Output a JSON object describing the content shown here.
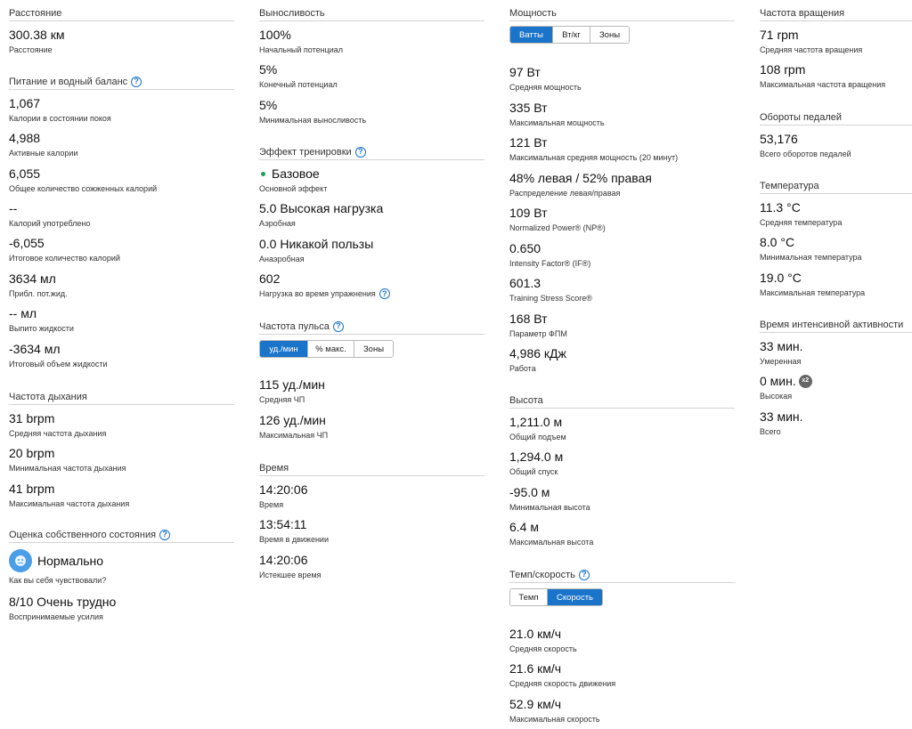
{
  "col1": {
    "distance": {
      "title": "Расстояние",
      "value": "300.38 км",
      "label": "Расстояние"
    },
    "nutrition": {
      "title": "Питание и водный баланс",
      "items": [
        {
          "value": "1,067",
          "label": "Калории в состоянии покоя"
        },
        {
          "value": "4,988",
          "label": "Активные калории"
        },
        {
          "value": "6,055",
          "label": "Общее количество сожженных калорий"
        },
        {
          "value": "--",
          "label": "Калорий употреблено"
        },
        {
          "value": "-6,055",
          "label": "Итоговое количество калорий"
        },
        {
          "value": "3634 мл",
          "label": "Прибл. пот.жид."
        },
        {
          "value": "-- мл",
          "label": "Выпито жидкости"
        },
        {
          "value": "-3634 мл",
          "label": "Итоговый объем жидкости"
        }
      ]
    },
    "breathing": {
      "title": "Частота дыхания",
      "items": [
        {
          "value": "31 brpm",
          "label": "Средняя частота дыхания"
        },
        {
          "value": "20 brpm",
          "label": "Минимальная частота дыхания"
        },
        {
          "value": "41 brpm",
          "label": "Максимальная частота дыхания"
        }
      ]
    },
    "self_eval": {
      "title": "Оценка собственного состояния",
      "feeling_value": "Нормально",
      "feeling_label": "Как вы себя чувствовали?",
      "effort_value": "8/10 Очень трудно",
      "effort_label": "Воспринимаемые усилия"
    }
  },
  "col2": {
    "stamina": {
      "title": "Выносливость",
      "items": [
        {
          "value": "100%",
          "label": "Начальный потенциал"
        },
        {
          "value": "5%",
          "label": "Конечный потенциал"
        },
        {
          "value": "5%",
          "label": "Минимальная выносливость"
        }
      ]
    },
    "training_effect": {
      "title": "Эффект тренировки",
      "primary_value": "Базовое",
      "primary_label": "Основной эффект",
      "aerobic_value": "5.0 Высокая нагрузка",
      "aerobic_label": "Аэробная",
      "anaerobic_value": "0.0 Никакой пользы",
      "anaerobic_label": "Анаэробная",
      "load_value": "602",
      "load_label": "Нагрузка во время упражнения"
    },
    "heart_rate": {
      "title": "Частота пульса",
      "tabs": [
        "уд./мин",
        "% макс.",
        "Зоны"
      ],
      "active_tab": "уд./мин",
      "items": [
        {
          "value": "115 уд./мин",
          "label": "Средняя ЧП"
        },
        {
          "value": "126 уд./мин",
          "label": "Максимальная ЧП"
        }
      ]
    },
    "time": {
      "title": "Время",
      "items": [
        {
          "value": "14:20:06",
          "label": "Время"
        },
        {
          "value": "13:54:11",
          "label": "Время в движении"
        },
        {
          "value": "14:20:06",
          "label": "Истекшее время"
        }
      ]
    }
  },
  "col3": {
    "power": {
      "title": "Мощность",
      "tabs": [
        "Ватты",
        "Вт/кг",
        "Зоны"
      ],
      "active_tab": "Ватты",
      "items": [
        {
          "value": "97 Вт",
          "label": "Средняя мощность"
        },
        {
          "value": "335 Вт",
          "label": "Максимальная мощность"
        },
        {
          "value": "121 Вт",
          "label": "Максимальная средняя мощность (20 минут)"
        },
        {
          "value": "48% левая / 52% правая",
          "label": "Распределение левая/правая"
        },
        {
          "value": "109 Вт",
          "label": "Normalized Power® (NP®)"
        },
        {
          "value": "0.650",
          "label": "Intensity Factor® (IF®)"
        },
        {
          "value": "601.3",
          "label": "Training Stress Score®"
        },
        {
          "value": "168 Вт",
          "label": "Параметр ФПМ"
        },
        {
          "value": "4,986 кДж",
          "label": "Работа"
        }
      ]
    },
    "elevation": {
      "title": "Высота",
      "items": [
        {
          "value": "1,211.0 м",
          "label": "Общий подъем"
        },
        {
          "value": "1,294.0 м",
          "label": "Общий спуск"
        },
        {
          "value": "-95.0 м",
          "label": "Минимальная высота"
        },
        {
          "value": "6.4 м",
          "label": "Максимальная высота"
        }
      ]
    },
    "pace_speed": {
      "title": "Темп/скорость",
      "tabs": [
        "Темп",
        "Скорость"
      ],
      "active_tab": "Скорость",
      "items": [
        {
          "value": "21.0 км/ч",
          "label": "Средняя скорость"
        },
        {
          "value": "21.6 км/ч",
          "label": "Средняя скорость движения"
        },
        {
          "value": "52.9 км/ч",
          "label": "Максимальная скорость"
        }
      ]
    }
  },
  "col4": {
    "cadence": {
      "title": "Частота вращения",
      "items": [
        {
          "value": "71 rpm",
          "label": "Средняя частота вращения"
        },
        {
          "value": "108 rpm",
          "label": "Максимальная частота вращения"
        }
      ]
    },
    "strokes": {
      "title": "Обороты педалей",
      "items": [
        {
          "value": "53,176",
          "label": "Всего оборотов педалей"
        }
      ]
    },
    "temperature": {
      "title": "Температура",
      "items": [
        {
          "value": "11.3 °C",
          "label": "Средняя температура"
        },
        {
          "value": "8.0 °C",
          "label": "Минимальная температура"
        },
        {
          "value": "19.0 °C",
          "label": "Максимальная температура"
        }
      ]
    },
    "intensity": {
      "title": "Время интенсивной активности",
      "moderate_value": "33 мин.",
      "moderate_label": "Умеренная",
      "vigorous_value": "0 мин.",
      "vigorous_badge": "x2",
      "vigorous_label": "Высокая",
      "total_value": "33 мин.",
      "total_label": "Всего"
    }
  },
  "icons": {
    "help": "?",
    "help_name": "help-circle-icon"
  },
  "colors": {
    "accent": "#1a74c9",
    "dot_green": "#1f9e5a",
    "divider": "#d4d4d4"
  }
}
